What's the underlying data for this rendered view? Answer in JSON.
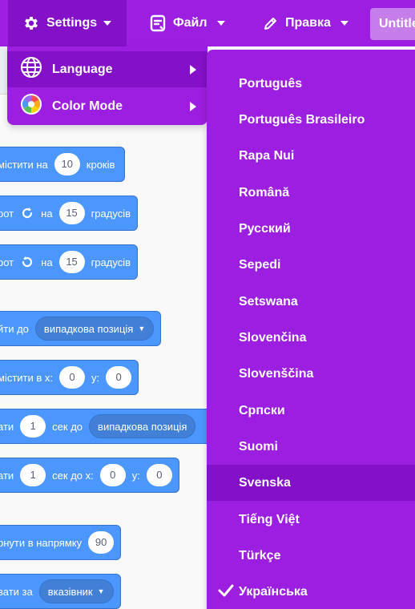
{
  "menubar": {
    "settings_label": "Settings",
    "file_label": "Файл",
    "edit_label": "Правка",
    "title_value": "Untitled"
  },
  "settings_dropdown": {
    "language_label": "Language",
    "color_mode_label": "Color Mode"
  },
  "language_menu": {
    "items": [
      "Português",
      "Português Brasileiro",
      "Rapa Nui",
      "Română",
      "Русский",
      "Sepedi",
      "Setswana",
      "Slovenčina",
      "Slovenščina",
      "Српски",
      "Suomi",
      "Svenska",
      "Tiếng Việt",
      "Türkçe",
      "Українська"
    ],
    "hovered": "Svenska",
    "checked": "Українська"
  },
  "blocks": {
    "move": {
      "text": "містити на",
      "value": "10",
      "suffix": "кроків"
    },
    "turn_right": {
      "text": "рот",
      "on": "на",
      "value": "15",
      "suffix": "градусів"
    },
    "turn_left": {
      "text": "рот",
      "on": "на",
      "value": "15",
      "suffix": "градусів"
    },
    "goto": {
      "text": "йти до",
      "dropdown": "випадкова позиція"
    },
    "goto_xy": {
      "text": "містити в x:",
      "x": "0",
      "ylabel": "y:",
      "y": "0"
    },
    "glide": {
      "text": "ати",
      "value": "1",
      "mid": "сек до",
      "dropdown": "випадкова позиція"
    },
    "glide_xy": {
      "text": "ати",
      "value": "1",
      "mid": "сек до x:",
      "x": "0",
      "ylabel": "y:",
      "y": "0"
    },
    "point_dir": {
      "text": "рнути в напрямку",
      "value": "90"
    },
    "point_towards": {
      "text": "вати за",
      "dropdown": "вказівник"
    }
  },
  "colors": {
    "menu_purple": "#9c1ee0",
    "menu_active": "#8410c8",
    "block_blue": "#4c97ff"
  }
}
